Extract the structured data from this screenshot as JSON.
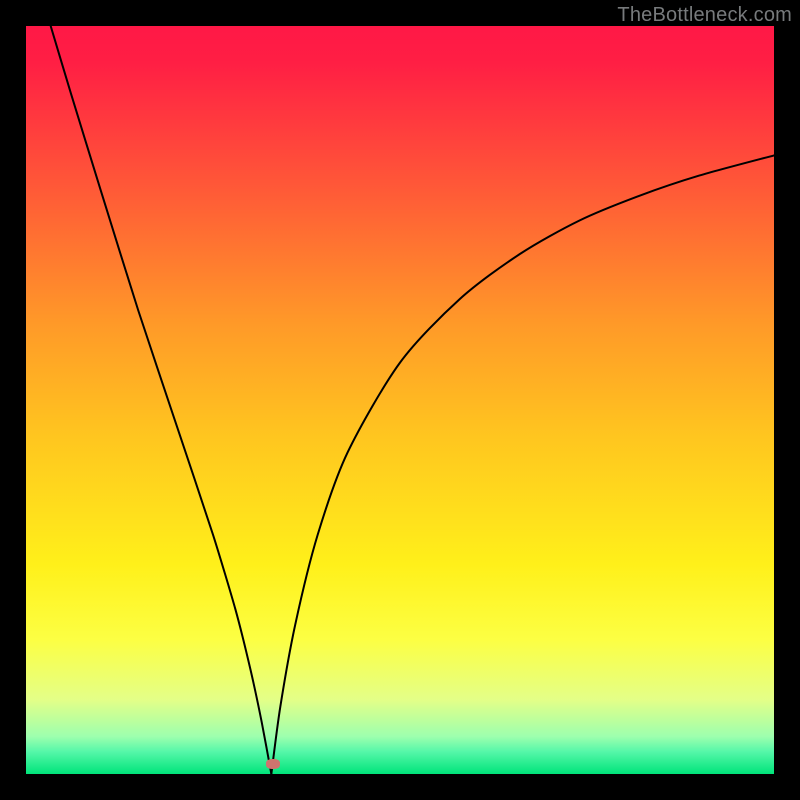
{
  "watermark": "TheBottleneck.com",
  "colors": {
    "black": "#000000",
    "curve": "#000000",
    "marker": "#cf746e",
    "gradient_stops": [
      {
        "pct": 0,
        "color": "#ff1846"
      },
      {
        "pct": 5,
        "color": "#ff1f44"
      },
      {
        "pct": 22,
        "color": "#ff5a37"
      },
      {
        "pct": 40,
        "color": "#ff9a28"
      },
      {
        "pct": 55,
        "color": "#ffc61f"
      },
      {
        "pct": 72,
        "color": "#fff01a"
      },
      {
        "pct": 82,
        "color": "#fcff43"
      },
      {
        "pct": 90,
        "color": "#e4ff87"
      },
      {
        "pct": 95,
        "color": "#9dffae"
      },
      {
        "pct": 97,
        "color": "#56f7a9"
      },
      {
        "pct": 100,
        "color": "#00e47a"
      }
    ]
  },
  "chart_data": {
    "type": "line",
    "title": "",
    "xlabel": "",
    "ylabel": "",
    "xlim": [
      0,
      100
    ],
    "ylim": [
      0,
      100
    ],
    "minimum_x": 32.8,
    "marker": {
      "x": 33.0,
      "y": 1.3
    },
    "series": [
      {
        "name": "left-branch",
        "x": [
          3.3,
          6,
          10,
          15,
          20,
          25,
          28,
          30,
          31.5,
          32.8
        ],
        "values": [
          100,
          91,
          78,
          62,
          47,
          32,
          22,
          14,
          7,
          0
        ]
      },
      {
        "name": "right-branch",
        "x": [
          32.8,
          34,
          36,
          39,
          43,
          50,
          58,
          66,
          74,
          82,
          90,
          100
        ],
        "values": [
          0,
          9,
          20,
          32,
          43,
          55,
          63.5,
          69.5,
          74,
          77.3,
          80,
          82.7
        ]
      }
    ]
  }
}
